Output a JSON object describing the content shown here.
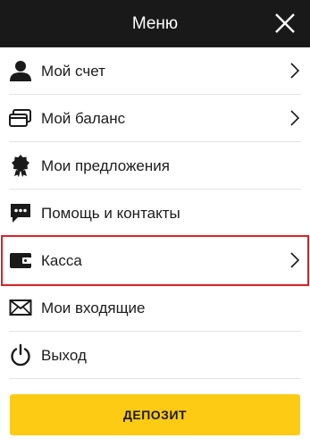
{
  "header": {
    "title": "Меню",
    "close_icon": "close-icon"
  },
  "menu": {
    "items": [
      {
        "label": "Мой счет",
        "icon": "user-icon",
        "has_chevron": true
      },
      {
        "label": "Мой баланс",
        "icon": "wallet-cards-icon",
        "has_chevron": true
      },
      {
        "label": "Мои предложения",
        "icon": "award-badge-icon",
        "has_chevron": false
      },
      {
        "label": "Помощь и контакты",
        "icon": "chat-bubble-icon",
        "has_chevron": false
      },
      {
        "label": "Касса",
        "icon": "wallet-icon",
        "has_chevron": true,
        "highlighted": true
      },
      {
        "label": "Мои входящие",
        "icon": "envelope-icon",
        "has_chevron": false
      },
      {
        "label": "Выход",
        "icon": "power-icon",
        "has_chevron": false
      }
    ]
  },
  "deposit_button": {
    "label": "ДЕПОЗИТ"
  },
  "colors": {
    "header_bg": "#191919",
    "accent": "#fdcb13",
    "highlight": "#d8232a"
  }
}
